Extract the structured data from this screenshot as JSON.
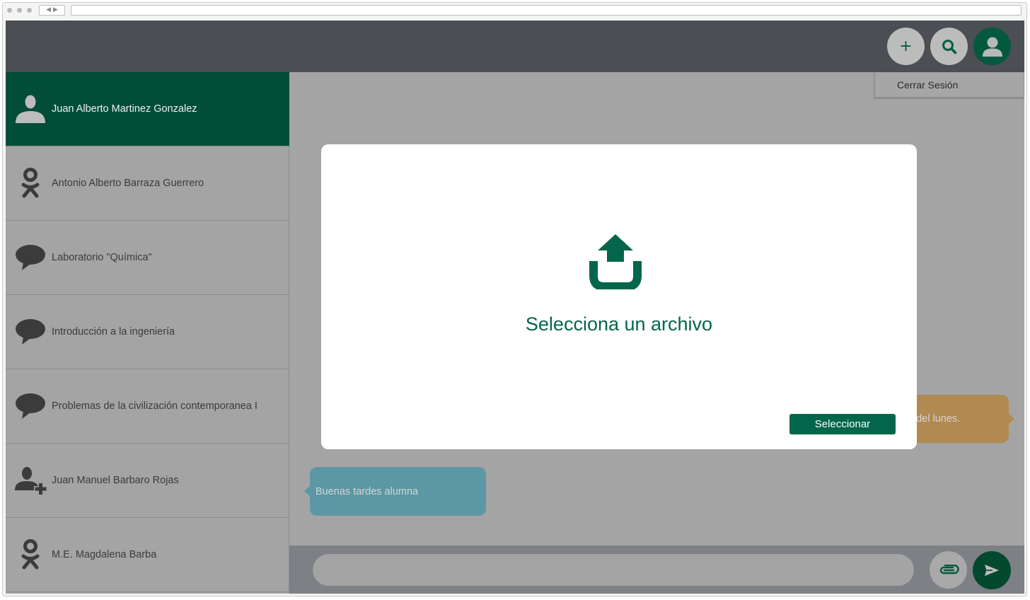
{
  "header": {
    "add_icon": "plus-icon",
    "search_icon": "search-icon",
    "profile_icon": "user-icon",
    "add_label": "+"
  },
  "profile_menu": {
    "logout_label": "Cerrar Sesión"
  },
  "sidebar": {
    "items": [
      {
        "label": "Juan Alberto Martinez Gonzalez",
        "icon": "user-icon",
        "active": true
      },
      {
        "label": "Antonio Alberto Barraza Guerrero",
        "icon": "odnoklassniki-icon",
        "active": false
      },
      {
        "label": "Laboratorio \"Química\"",
        "icon": "chat-bubble-icon",
        "active": false
      },
      {
        "label": "Introducción a la ingeniería",
        "icon": "chat-bubble-icon",
        "active": false
      },
      {
        "label": "Problemas de la civilización contemporanea I",
        "icon": "chat-bubble-icon",
        "active": false
      },
      {
        "label": "Juan Manuel Barbaro Rojas",
        "icon": "user-plus-icon",
        "active": false
      },
      {
        "label": "M.E. Magdalena Barba",
        "icon": "odnoklassniki-icon",
        "active": false
      }
    ]
  },
  "messages": {
    "outgoing_partial": "o del lunes.",
    "incoming": "Buenas tardes alumna"
  },
  "composer": {
    "placeholder": "",
    "attach_icon": "paperclip-icon",
    "send_icon": "send-icon"
  },
  "modal": {
    "icon": "upload-icon",
    "title": "Selecciona un archivo",
    "button_label": "Seleccionar"
  },
  "colors": {
    "brand_green": "#03664a",
    "sidebar_active": "#024d38",
    "topbar": "#4b4e52",
    "bubble_outgoing": "#b18a52",
    "bubble_incoming": "#5b98a4"
  }
}
